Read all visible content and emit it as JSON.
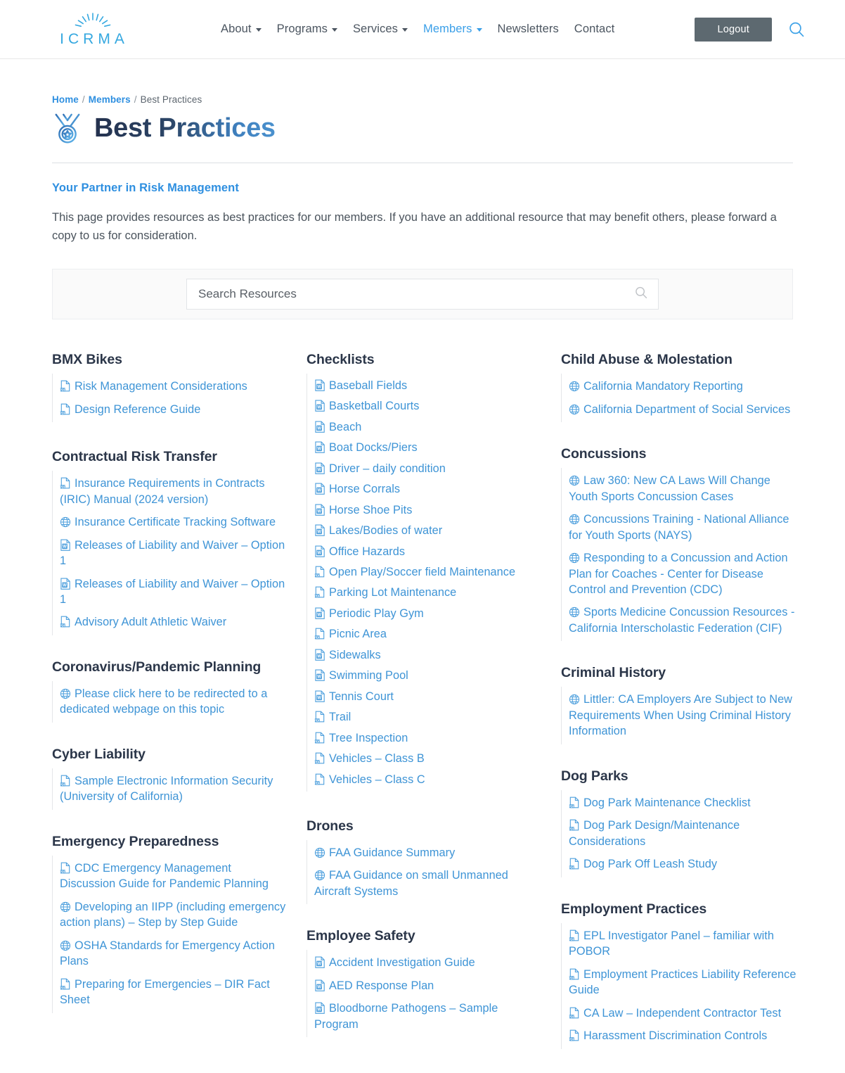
{
  "header": {
    "brand_word": "ICRMA",
    "nav": [
      {
        "label": "About",
        "has_caret": true,
        "active": false
      },
      {
        "label": "Programs",
        "has_caret": true,
        "active": false
      },
      {
        "label": "Services",
        "has_caret": true,
        "active": false
      },
      {
        "label": "Members",
        "has_caret": true,
        "active": true
      },
      {
        "label": "Newsletters",
        "has_caret": false,
        "active": false
      },
      {
        "label": "Contact",
        "has_caret": false,
        "active": false
      }
    ],
    "logout_label": "Logout",
    "search_icon": "search-icon",
    "accent_color": "#35a8e0",
    "logout_bg": "#5d6970"
  },
  "breadcrumb": {
    "home": "Home",
    "members": "Members",
    "current": "Best Practices",
    "separator": "/"
  },
  "page": {
    "title": "Best Practices",
    "title_icon": "medal-icon",
    "lede": "Your Partner in Risk Management",
    "intro": "This page provides resources as best practices for our members. If you have an additional resource that may benefit others, please forward a copy to us for consideration."
  },
  "search": {
    "placeholder": "Search Resources",
    "value": "",
    "icon": "search-icon"
  },
  "columns": [
    {
      "groups": [
        {
          "title": "BMX Bikes",
          "links": [
            {
              "icon": "pdf-icon",
              "label": "Risk Management Considerations"
            },
            {
              "icon": "pdf-icon",
              "label": "Design Reference Guide"
            }
          ]
        },
        {
          "title": "Contractual Risk Transfer",
          "links": [
            {
              "icon": "pdf-icon",
              "label": "Insurance Requirements in Contracts (IRIC) Manual (2024 version)"
            },
            {
              "icon": "globe-icon",
              "label": "Insurance Certificate Tracking Software"
            },
            {
              "icon": "word-icon",
              "label": "Releases of Liability and Waiver – Option 1"
            },
            {
              "icon": "word-icon",
              "label": "Releases of Liability and Waiver – Option 1"
            },
            {
              "icon": "pdf-icon",
              "label": "Advisory Adult Athletic Waiver"
            }
          ]
        },
        {
          "title": "Coronavirus/Pandemic Planning",
          "links": [
            {
              "icon": "globe-icon",
              "label": "Please click here to be redirected to a dedicated webpage on this topic"
            }
          ]
        },
        {
          "title": "Cyber Liability",
          "links": [
            {
              "icon": "pdf-icon",
              "label": "Sample Electronic Information Security (University of California)"
            }
          ]
        },
        {
          "title": "Emergency Preparedness",
          "links": [
            {
              "icon": "pdf-icon",
              "label": "CDC Emergency Management Discussion Guide for Pandemic Planning"
            },
            {
              "icon": "globe-icon",
              "label": "Developing an IIPP (including emergency action plans) – Step by Step Guide"
            },
            {
              "icon": "globe-icon",
              "label": "OSHA Standards for Emergency Action Plans"
            },
            {
              "icon": "pdf-icon",
              "label": "Preparing for Emergencies – DIR Fact Sheet"
            }
          ]
        }
      ]
    },
    {
      "groups": [
        {
          "title": "Checklists",
          "links": [
            {
              "icon": "word-icon",
              "label": "Baseball Fields"
            },
            {
              "icon": "word-icon",
              "label": "Basketball Courts"
            },
            {
              "icon": "word-icon",
              "label": "Beach"
            },
            {
              "icon": "word-icon",
              "label": "Boat Docks/Piers"
            },
            {
              "icon": "word-icon",
              "label": "Driver – daily condition"
            },
            {
              "icon": "word-icon",
              "label": "Horse Corrals"
            },
            {
              "icon": "word-icon",
              "label": "Horse Shoe Pits"
            },
            {
              "icon": "word-icon",
              "label": "Lakes/Bodies of water"
            },
            {
              "icon": "word-icon",
              "label": "Office Hazards"
            },
            {
              "icon": "pdf-icon",
              "label": "Open Play/Soccer field Maintenance"
            },
            {
              "icon": "pdf-icon",
              "label": "Parking Lot Maintenance"
            },
            {
              "icon": "word-icon",
              "label": "Periodic Play Gym"
            },
            {
              "icon": "pdf-icon",
              "label": "Picnic Area"
            },
            {
              "icon": "word-icon",
              "label": "Sidewalks"
            },
            {
              "icon": "word-icon",
              "label": "Swimming Pool"
            },
            {
              "icon": "word-icon",
              "label": "Tennis Court"
            },
            {
              "icon": "pdf-icon",
              "label": "Trail"
            },
            {
              "icon": "pdf-icon",
              "label": "Tree Inspection"
            },
            {
              "icon": "pdf-icon",
              "label": "Vehicles – Class B"
            },
            {
              "icon": "pdf-icon",
              "label": "Vehicles – Class C"
            }
          ]
        },
        {
          "title": "Drones",
          "links": [
            {
              "icon": "globe-icon",
              "label": "FAA Guidance Summary"
            },
            {
              "icon": "globe-icon",
              "label": "FAA Guidance on small Unmanned Aircraft Systems"
            }
          ]
        },
        {
          "title": "Employee Safety",
          "links": [
            {
              "icon": "word-icon",
              "label": "Accident Investigation Guide"
            },
            {
              "icon": "word-icon",
              "label": "AED Response Plan"
            },
            {
              "icon": "word-icon",
              "label": "Bloodborne Pathogens – Sample Program"
            }
          ]
        }
      ]
    },
    {
      "groups": [
        {
          "title": "Child Abuse & Molestation",
          "links": [
            {
              "icon": "globe-icon",
              "label": "California Mandatory Reporting"
            },
            {
              "icon": "globe-icon",
              "label": "California Department of Social Services"
            }
          ]
        },
        {
          "title": "Concussions",
          "links": [
            {
              "icon": "globe-icon",
              "label": "Law 360: New CA Laws Will Change Youth Sports Concussion Cases"
            },
            {
              "icon": "globe-icon",
              "label": "Concussions Training - National Alliance for Youth Sports (NAYS)"
            },
            {
              "icon": "globe-icon",
              "label": "Responding to a Concussion and Action Plan for Coaches - Center for Disease Control and Prevention (CDC)"
            },
            {
              "icon": "globe-icon",
              "label": "Sports Medicine Concussion Resources - California Interscholastic Federation (CIF)"
            }
          ]
        },
        {
          "title": "Criminal History",
          "links": [
            {
              "icon": "globe-icon",
              "label": "Littler: CA Employers Are Subject to New Requirements When Using Criminal History Information"
            }
          ]
        },
        {
          "title": "Dog Parks",
          "links": [
            {
              "icon": "pdf-icon",
              "label": "Dog Park Maintenance Checklist"
            },
            {
              "icon": "pdf-icon",
              "label": "Dog Park Design/Maintenance Considerations"
            },
            {
              "icon": "pdf-icon",
              "label": "Dog Park Off Leash Study"
            }
          ]
        },
        {
          "title": "Employment Practices",
          "links": [
            {
              "icon": "pdf-icon",
              "label": "EPL Investigator Panel – familiar with POBOR"
            },
            {
              "icon": "pdf-icon",
              "label": "Employment Practices Liability Reference Guide"
            },
            {
              "icon": "pdf-icon",
              "label": "CA Law – Independent Contractor Test"
            },
            {
              "icon": "pdf-icon",
              "label": "Harassment Discrimination Controls"
            }
          ]
        }
      ]
    }
  ]
}
